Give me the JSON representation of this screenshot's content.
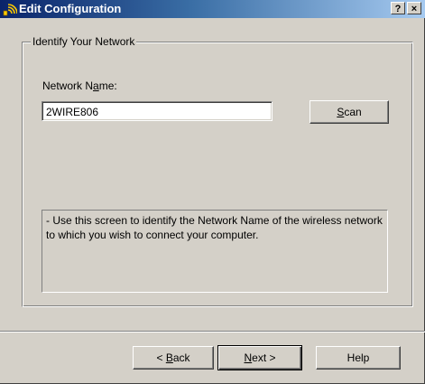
{
  "window": {
    "title": "Edit Configuration",
    "help_button": "?",
    "close_button": "×"
  },
  "group": {
    "label": "Identify Your Network"
  },
  "network_name": {
    "label_pre": "Network N",
    "label_accel": "a",
    "label_post": "me:",
    "value": "2WIRE806"
  },
  "scan_button": {
    "accel": "S",
    "rest": "can"
  },
  "info_text": "- Use this screen to identify the Network Name of the wireless network to which you wish to connect your computer.",
  "buttons": {
    "back_prefix": "< ",
    "back_accel": "B",
    "back_rest": "ack",
    "next_accel": "N",
    "next_rest": "ext >",
    "help": "Help"
  },
  "colors": {
    "dialog_face": "#d4d0c8",
    "title_start": "#0a246a",
    "title_end": "#a6caf0"
  },
  "icons": {
    "title": "wireless-signal-icon"
  }
}
